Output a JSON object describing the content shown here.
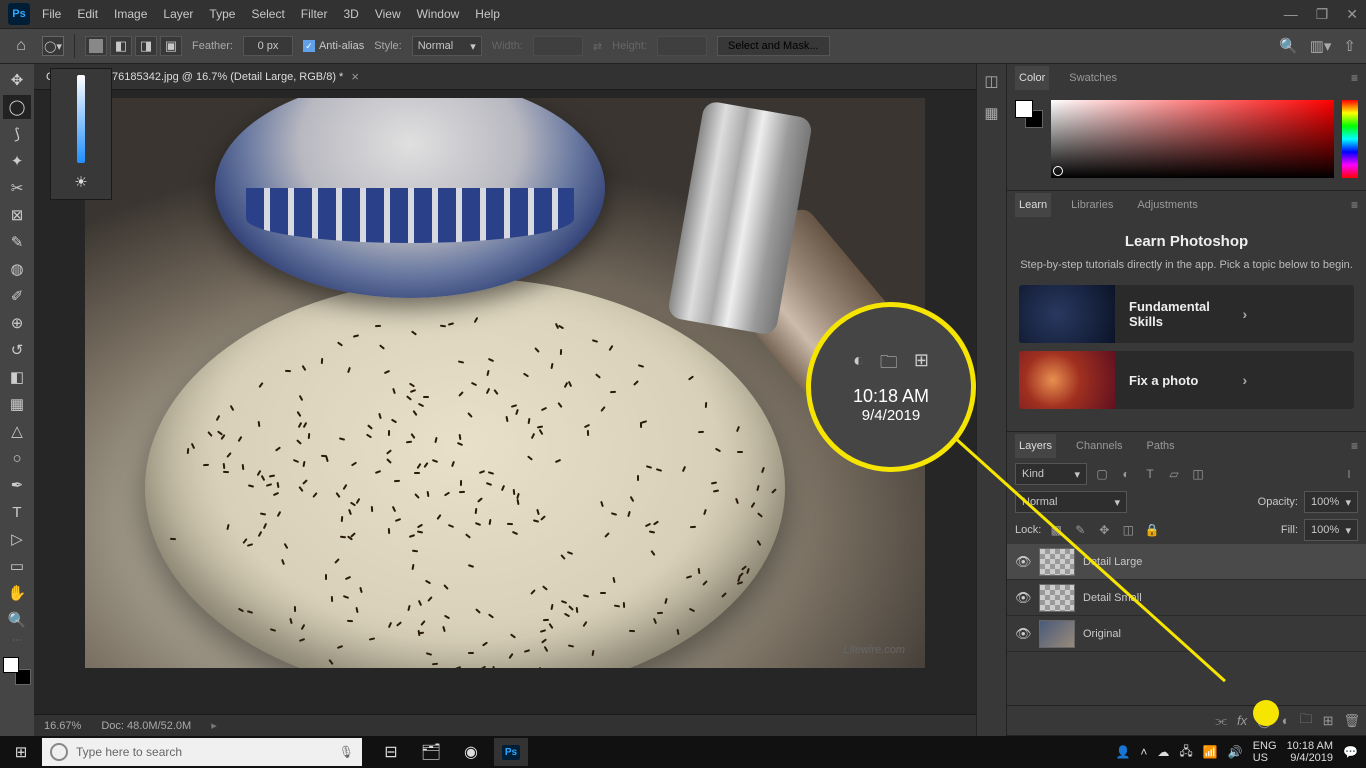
{
  "menu": [
    "File",
    "Edit",
    "Image",
    "Layer",
    "Type",
    "Select",
    "Filter",
    "3D",
    "View",
    "Window",
    "Help"
  ],
  "optbar": {
    "feather_label": "Feather:",
    "feather_val": "0 px",
    "antialias": "Anti-alias",
    "style_label": "Style:",
    "style_val": "Normal",
    "width": "Width:",
    "height": "Height:",
    "mask": "Select and Mask..."
  },
  "doc": {
    "tab": "GettyImages-76185342.jpg @ 16.7% (Detail Large, RGB/8) *",
    "watermark": "Lifewire.com"
  },
  "status": {
    "zoom": "16.67%",
    "doc": "Doc: 48.0M/52.0M"
  },
  "panel_tabs": {
    "color": "Color",
    "swatches": "Swatches",
    "learn": "Learn",
    "libraries": "Libraries",
    "adjustments": "Adjustments",
    "layers": "Layers",
    "channels": "Channels",
    "paths": "Paths"
  },
  "learn": {
    "title": "Learn Photoshop",
    "desc": "Step-by-step tutorials directly in the app. Pick a topic below to begin.",
    "c1": "Fundamental Skills",
    "c2": "Fix a photo"
  },
  "layers": {
    "kind": "Kind",
    "blend": "Normal",
    "opacity_l": "Opacity:",
    "opacity_v": "100%",
    "lock_l": "Lock:",
    "fill_l": "Fill:",
    "fill_v": "100%",
    "l1": "Detail Large",
    "l2": "Detail Small",
    "l3": "Original"
  },
  "callout": {
    "time": "10:18 AM",
    "date": "9/4/2019"
  },
  "taskbar": {
    "search": "Type here to search",
    "lang1": "ENG",
    "lang2": "US",
    "time": "10:18 AM",
    "date": "9/4/2019"
  }
}
